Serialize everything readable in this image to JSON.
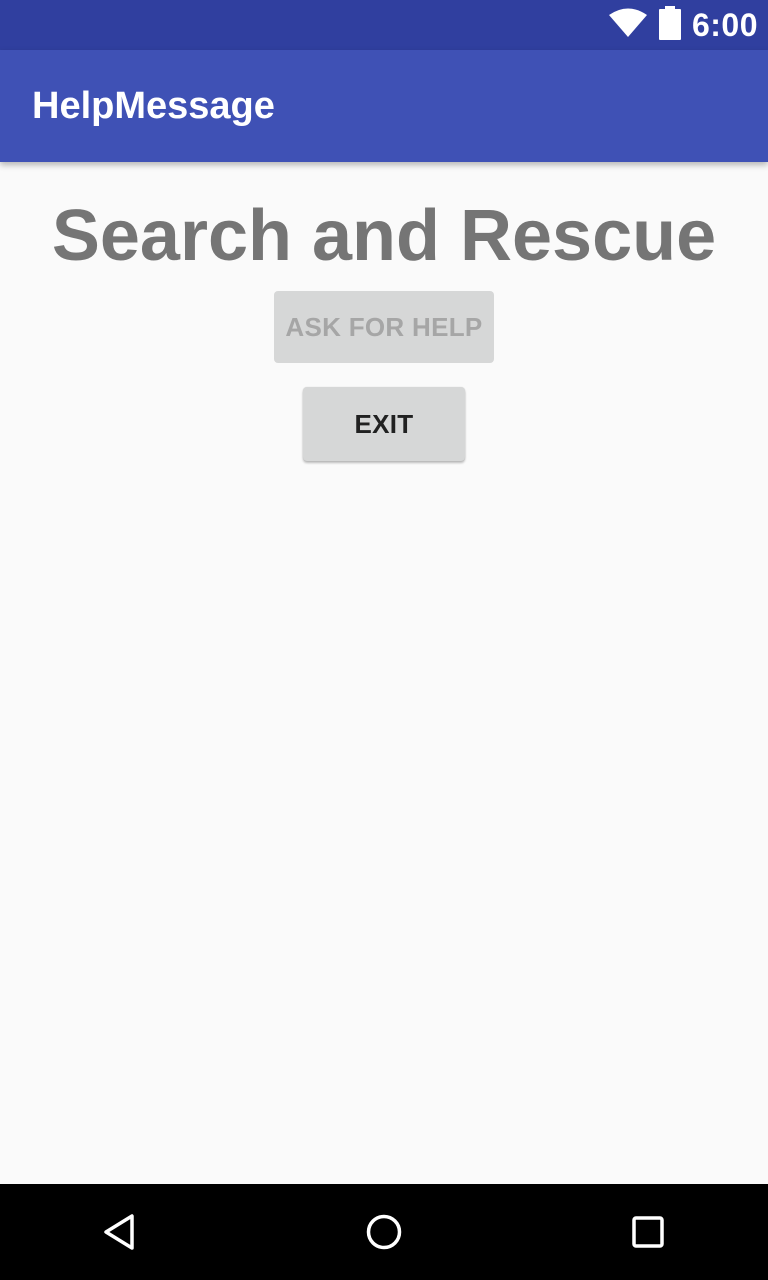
{
  "status_bar": {
    "time": "6:00",
    "icons": [
      "wifi-icon",
      "battery-icon"
    ],
    "background": "#303f9f"
  },
  "app_bar": {
    "title": "HelpMessage",
    "background": "#3f51b5"
  },
  "main": {
    "headline": "Search and Rescue",
    "ask_help_label": "ASK FOR HELP",
    "ask_help_enabled": false,
    "exit_label": "EXIT"
  },
  "nav_bar": {
    "buttons": [
      "back-icon",
      "home-icon",
      "recents-icon"
    ]
  }
}
